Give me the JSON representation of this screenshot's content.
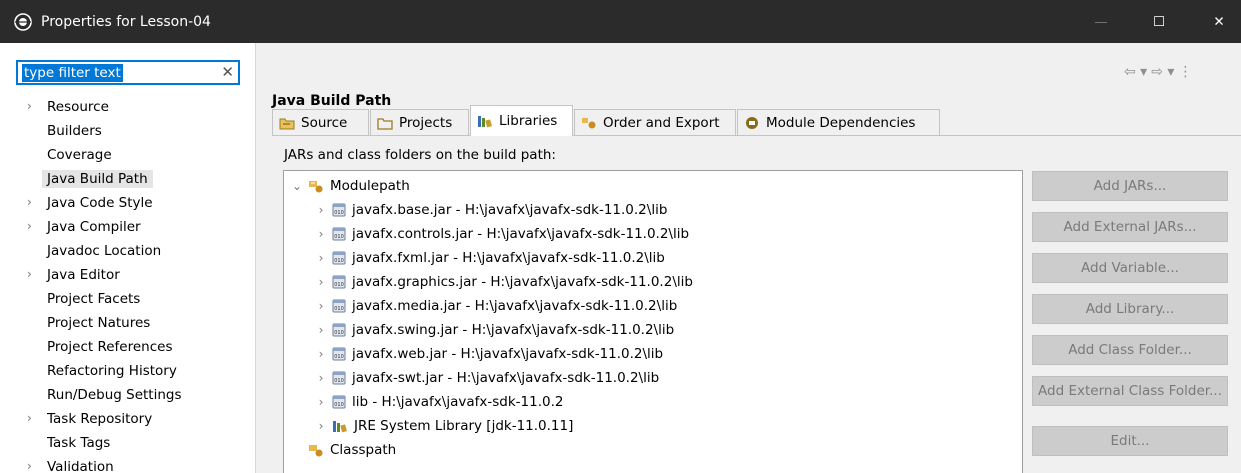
{
  "window": {
    "title": "Properties for Lesson-04",
    "minimize_glyph": "—",
    "maximize_glyph": "☐",
    "close_glyph": "✕"
  },
  "filter": {
    "value": "type filter text",
    "clear_glyph": "✕"
  },
  "nav": {
    "items": [
      {
        "label": "Resource",
        "expandable": true
      },
      {
        "label": "Builders",
        "expandable": false
      },
      {
        "label": "Coverage",
        "expandable": false
      },
      {
        "label": "Java Build Path",
        "expandable": false,
        "selected": true
      },
      {
        "label": "Java Code Style",
        "expandable": true
      },
      {
        "label": "Java Compiler",
        "expandable": true
      },
      {
        "label": "Javadoc Location",
        "expandable": false
      },
      {
        "label": "Java Editor",
        "expandable": true
      },
      {
        "label": "Project Facets",
        "expandable": false
      },
      {
        "label": "Project Natures",
        "expandable": false
      },
      {
        "label": "Project References",
        "expandable": false
      },
      {
        "label": "Refactoring History",
        "expandable": false
      },
      {
        "label": "Run/Debug Settings",
        "expandable": false
      },
      {
        "label": "Task Repository",
        "expandable": true
      },
      {
        "label": "Task Tags",
        "expandable": false
      },
      {
        "label": "Validation",
        "expandable": true
      }
    ]
  },
  "header": {
    "title": "Java Build Path",
    "back_glyph": "⇦ ▾",
    "forward_glyph": "⇨ ▾",
    "menu_glyph": "⋮"
  },
  "tabs": [
    {
      "label": "Source",
      "icon": "source-folder-icon"
    },
    {
      "label": "Projects",
      "icon": "projects-folder-icon"
    },
    {
      "label": "Libraries",
      "icon": "libraries-icon",
      "active": true
    },
    {
      "label": "Order and Export",
      "icon": "order-export-icon"
    },
    {
      "label": "Module Dependencies",
      "icon": "module-icon"
    }
  ],
  "subtitle": "JARs and class folders on the build path:",
  "tree": {
    "modulepath": "Modulepath",
    "classpath": "Classpath",
    "entries": [
      {
        "label": "javafx.base.jar - H:\\javafx\\javafx-sdk-11.0.2\\lib",
        "icon": "jar-icon"
      },
      {
        "label": "javafx.controls.jar - H:\\javafx\\javafx-sdk-11.0.2\\lib",
        "icon": "jar-icon"
      },
      {
        "label": "javafx.fxml.jar - H:\\javafx\\javafx-sdk-11.0.2\\lib",
        "icon": "jar-icon"
      },
      {
        "label": "javafx.graphics.jar - H:\\javafx\\javafx-sdk-11.0.2\\lib",
        "icon": "jar-icon"
      },
      {
        "label": "javafx.media.jar - H:\\javafx\\javafx-sdk-11.0.2\\lib",
        "icon": "jar-icon"
      },
      {
        "label": "javafx.swing.jar - H:\\javafx\\javafx-sdk-11.0.2\\lib",
        "icon": "jar-icon"
      },
      {
        "label": "javafx.web.jar - H:\\javafx\\javafx-sdk-11.0.2\\lib",
        "icon": "jar-icon"
      },
      {
        "label": "javafx-swt.jar - H:\\javafx\\javafx-sdk-11.0.2\\lib",
        "icon": "jar-icon"
      },
      {
        "label": "lib - H:\\javafx\\javafx-sdk-11.0.2",
        "icon": "jar-icon"
      },
      {
        "label": "JRE System Library [jdk-11.0.11]",
        "icon": "library-icon"
      }
    ]
  },
  "buttons": [
    {
      "label": "Add JARs...",
      "enabled": false
    },
    {
      "label": "Add External JARs...",
      "enabled": false
    },
    {
      "label": "Add Variable...",
      "enabled": false
    },
    {
      "label": "Add Library...",
      "enabled": false
    },
    {
      "label": "Add Class Folder...",
      "enabled": false
    },
    {
      "label": "Add External Class Folder...",
      "enabled": false
    },
    {
      "label": "Edit...",
      "enabled": false
    }
  ],
  "colors": {
    "titlebar": "#2b2b2b",
    "selection": "#0078d7",
    "button_disabled_bg": "#cccccc",
    "button_disabled_text": "#7a7a7a"
  }
}
